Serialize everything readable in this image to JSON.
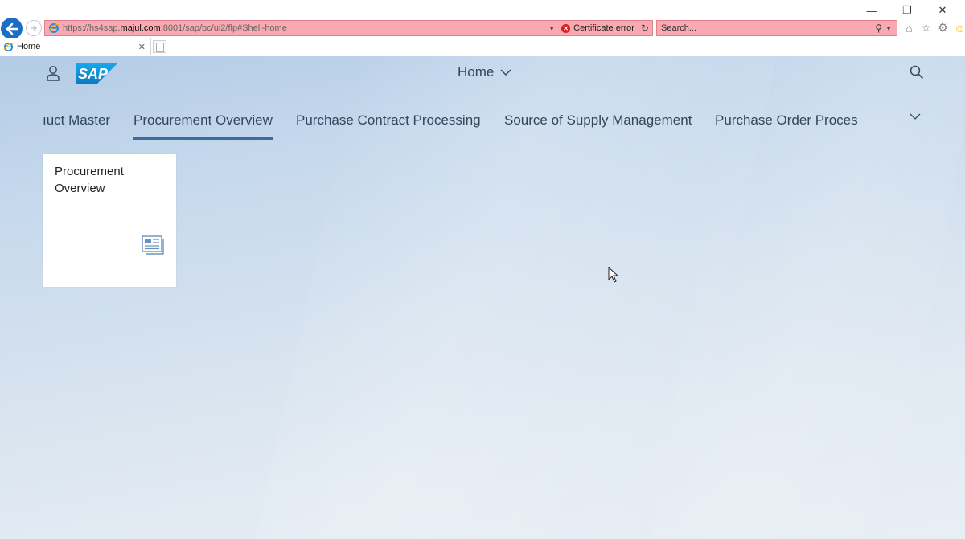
{
  "browser": {
    "url_prefix": "https://hs4sap.",
    "url_domain": "majul.com",
    "url_suffix": ":8001/sap/bc/ui2/flp#Shell-home",
    "certificate_label": "Certificate error",
    "search_placeholder": "Search...",
    "tab_title": "Home",
    "window_controls": {
      "minimize": "—",
      "restore": "❐",
      "close": "✕"
    }
  },
  "shell": {
    "title": "Home",
    "nav_items": [
      {
        "label": "Product Master",
        "shown": "ıuct Master"
      },
      {
        "label": "Procurement Overview",
        "active": true
      },
      {
        "label": "Purchase Contract Processing"
      },
      {
        "label": "Source of Supply Management"
      },
      {
        "label": "Purchase Order Proces"
      }
    ]
  },
  "tiles": [
    {
      "title": "Procurement Overview",
      "icon": "overview-card-icon"
    }
  ],
  "colors": {
    "address_bar_error": "#f8a9b2",
    "sap_blue": "#1a9de0",
    "active_tab_underline": "#3c6b9c",
    "shell_text": "#32475c"
  }
}
